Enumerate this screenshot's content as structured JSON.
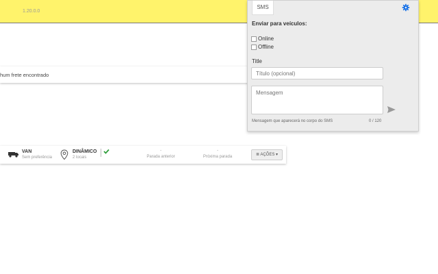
{
  "app": {
    "version": "1.20.0.0"
  },
  "freight": {
    "empty_text": "hum frete encontrado"
  },
  "route": {
    "vehicle_title": "VAN",
    "vehicle_sub": "Sem preferência",
    "mode_title": "DINÂMICO",
    "mode_sub": "2 locais",
    "prev_value": "-",
    "prev_label": "Parada anterior",
    "next_value": "-",
    "next_label": "Próxima parada",
    "actions_label": "AÇÕES"
  },
  "sms_panel": {
    "tab_label": "SMS",
    "send_to_label": "Enviar para veículos:",
    "options": [
      "Online",
      "Offline"
    ],
    "title_label": "Title",
    "title_placeholder": "Título (opcional)",
    "message_placeholder": "Mensagem",
    "message_hint": "Mensagem que aparecerá no corpo do SMS",
    "char_count": "0 / 120"
  },
  "colors": {
    "topbar": "#fff36b",
    "accent": "#1a73e8",
    "check": "#2e9d3a"
  },
  "icons": [
    "truck-icon",
    "map-pin-icon",
    "check-icon",
    "list-icon",
    "caret-down-icon",
    "gear-icon",
    "send-icon"
  ]
}
